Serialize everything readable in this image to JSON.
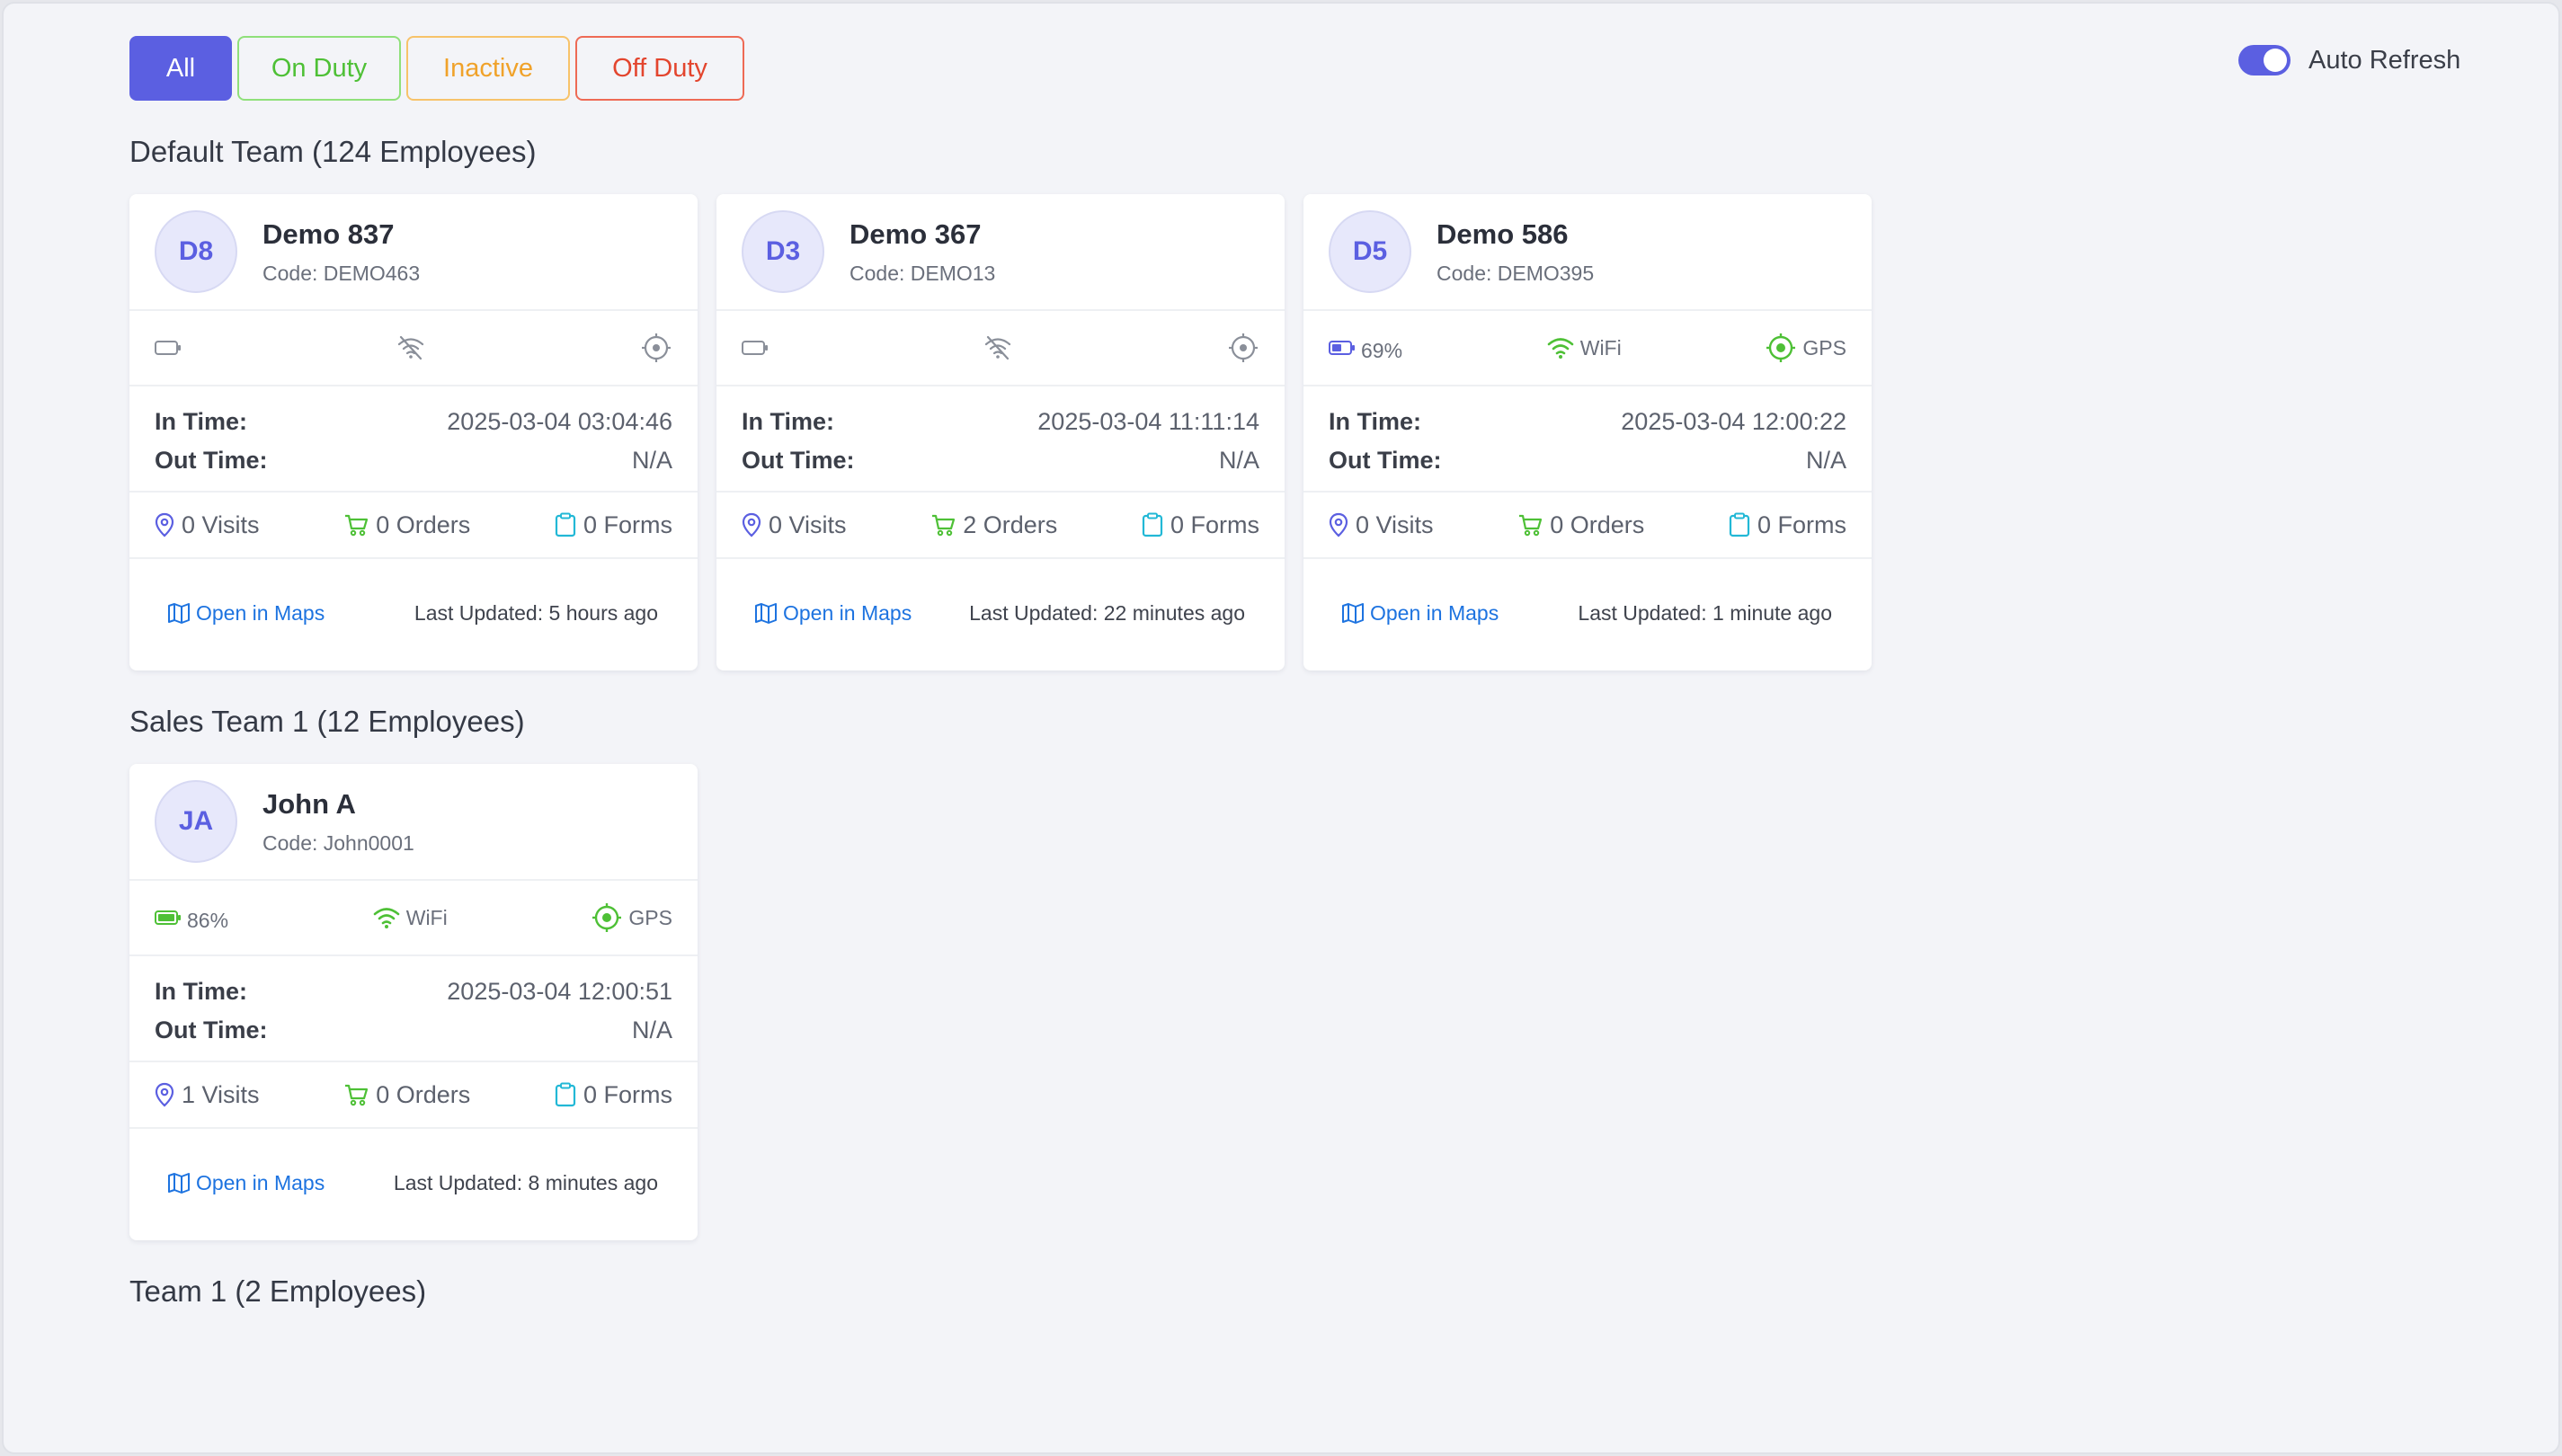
{
  "filters": {
    "all": "All",
    "on_duty": "On Duty",
    "inactive": "Inactive",
    "off_duty": "Off Duty"
  },
  "auto_refresh": {
    "label": "Auto Refresh",
    "enabled": true
  },
  "colors": {
    "accent": "#5b5fe1",
    "on_duty": "#4ec036",
    "inactive": "#f0a22a",
    "off_duty": "#e3452e",
    "link": "#1d73e0"
  },
  "labels": {
    "in_time": "In Time:",
    "out_time": "Out Time:",
    "open_in_maps": "Open in Maps"
  },
  "teams": [
    {
      "title": "Default Team (124 Employees)",
      "employees": [
        {
          "initials": "D8",
          "name": "Demo 837",
          "code": "Code: DEMO463",
          "battery": "",
          "wifi": "",
          "gps": "",
          "in_time": "2025-03-04 03:04:46",
          "out_time": "N/A",
          "visits": "0 Visits",
          "orders": "0 Orders",
          "forms": "0 Forms",
          "last_updated": "Last Updated: 5 hours ago"
        },
        {
          "initials": "D3",
          "name": "Demo 367",
          "code": "Code: DEMO13",
          "battery": "",
          "wifi": "",
          "gps": "",
          "in_time": "2025-03-04 11:11:14",
          "out_time": "N/A",
          "visits": "0 Visits",
          "orders": "2 Orders",
          "forms": "0 Forms",
          "last_updated": "Last Updated: 22 minutes ago"
        },
        {
          "initials": "D5",
          "name": "Demo 586",
          "code": "Code: DEMO395",
          "battery": "69%",
          "wifi": "WiFi",
          "gps": "GPS",
          "in_time": "2025-03-04 12:00:22",
          "out_time": "N/A",
          "visits": "0 Visits",
          "orders": "0 Orders",
          "forms": "0 Forms",
          "last_updated": "Last Updated: 1 minute ago"
        }
      ]
    },
    {
      "title": "Sales Team 1 (12 Employees)",
      "employees": [
        {
          "initials": "JA",
          "name": "John A",
          "code": "Code: John0001",
          "battery": "86%",
          "wifi": "WiFi",
          "gps": "GPS",
          "in_time": "2025-03-04 12:00:51",
          "out_time": "N/A",
          "visits": "1 Visits",
          "orders": "0 Orders",
          "forms": "0 Forms",
          "last_updated": "Last Updated: 8 minutes ago"
        }
      ]
    },
    {
      "title": "Team 1 (2 Employees)",
      "employees": []
    }
  ]
}
